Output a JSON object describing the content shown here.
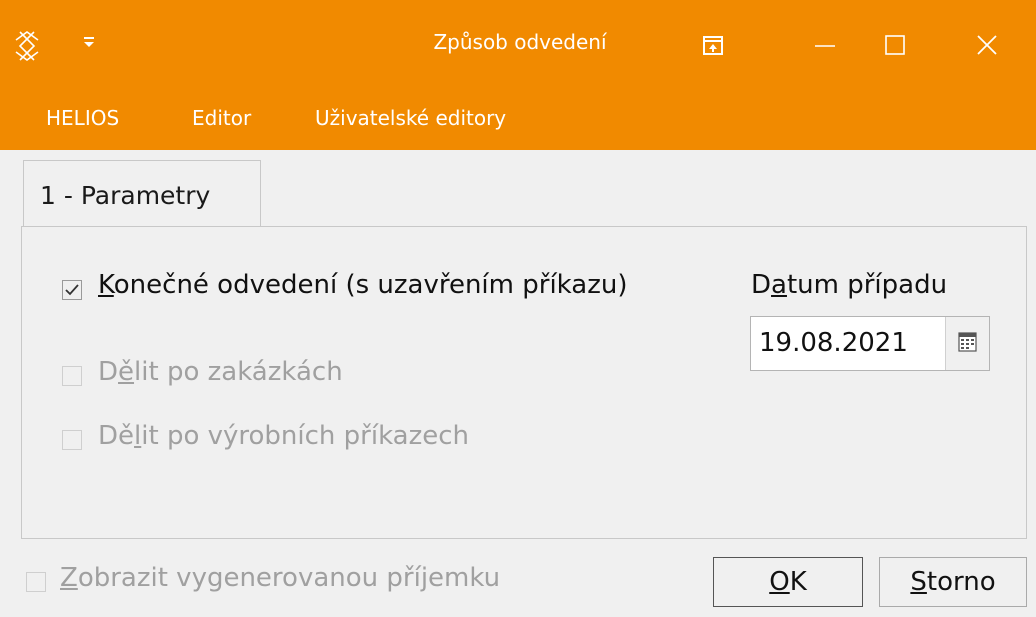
{
  "window": {
    "title": "Způsob odvedení",
    "brand_color": "#f18a00",
    "icons": [
      "helios-logo-icon",
      "quick-access-dropdown-icon",
      "restore-panel-icon",
      "minimize-icon",
      "maximize-icon",
      "close-icon"
    ]
  },
  "menu": {
    "items": [
      "HELIOS",
      "Editor",
      "Uživatelské editory"
    ]
  },
  "tabs": [
    {
      "label": "1 - Parametry",
      "active": true
    }
  ],
  "parameters": {
    "final_transfer": {
      "mnemonic": "K",
      "rest": "onečné odvedení (s uzavřením příkazu)",
      "checked": true,
      "enabled": true
    },
    "split_by_orders": {
      "pre": "D",
      "mnemonic": "ě",
      "rest": "lit po zakázkách",
      "checked": false,
      "enabled": false
    },
    "split_by_production": {
      "pre": "Dě",
      "mnemonic": "l",
      "rest": "it po výrobních příkazech",
      "checked": false,
      "enabled": false
    }
  },
  "case_date": {
    "label_pre": "D",
    "label_mnemonic": "a",
    "label_rest": "tum případu",
    "value": "19.08.2021"
  },
  "footer": {
    "show_receipt": {
      "mnemonic": "Z",
      "rest": "obrazit vygenerovanou příjemku",
      "checked": false,
      "enabled": false
    },
    "ok": {
      "mnemonic": "O",
      "rest": "K"
    },
    "cancel": {
      "mnemonic": "S",
      "rest": "torno"
    }
  }
}
